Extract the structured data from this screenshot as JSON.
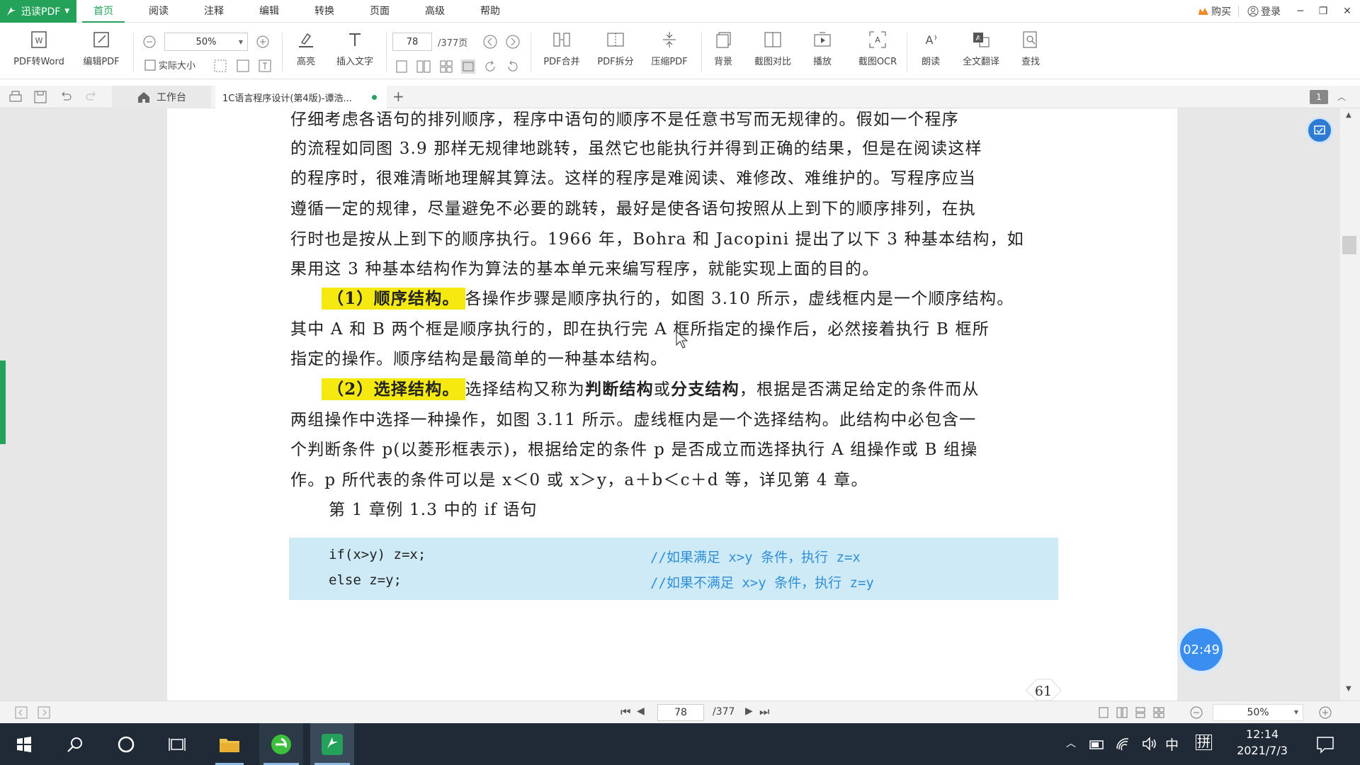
{
  "app": {
    "name": "迅读PDF"
  },
  "menu": {
    "items": [
      "首页",
      "阅读",
      "注释",
      "编辑",
      "转换",
      "页面",
      "高级",
      "帮助"
    ],
    "active": "首页"
  },
  "window": {
    "buy": "购买",
    "login": "登录"
  },
  "toolbar": {
    "pdf_to_word": "PDF转Word",
    "edit_pdf": "编辑PDF",
    "zoom_value": "50%",
    "actual_size": "实际大小",
    "highlight": "高亮",
    "insert_text": "插入文字",
    "page_current": "78",
    "page_total": "/377页",
    "pdf_merge": "PDF合并",
    "pdf_split": "PDF拆分",
    "compress_pdf": "压缩PDF",
    "background": "背景",
    "screenshot_compare": "截图对比",
    "play": "播放",
    "screenshot_ocr": "截图OCR",
    "read_aloud": "朗读",
    "full_translate": "全文翻译",
    "search": "查找"
  },
  "tabs": {
    "home": "工作台",
    "document": "1C语言程序设计(第4版)-谭浩...",
    "add": "+",
    "page_badge": "1"
  },
  "document": {
    "lines": [
      "仔细考虑各语句的排列顺序，程序中语句的顺序不是任意书写而无规律的。假如一个程序",
      "的流程如同图 3.9 那样无规律地跳转，虽然它也能执行并得到正确的结果，但是在阅读这样",
      "的程序时，很难清晰地理解其算法。这样的程序是难阅读、难修改、难维护的。写程序应当",
      "遵循一定的规律，尽量避免不必要的跳转，最好是使各语句按照从上到下的顺序排列，在执",
      "行时也是按从上到下的顺序执行。1966 年，Bohra 和 Jacopini 提出了以下 3 种基本结构，如",
      "果用这 3 种基本结构作为算法的基本单元来编写程序，就能实现上面的目的。"
    ],
    "seq_heading": "（1）顺序结构。",
    "seq_rest": "各操作步骤是顺序执行的，如图 3.10 所示，虚线框内是一个顺序结构。",
    "seq_line2": "其中 A 和 B 两个框是顺序执行的，即在执行完 A 框所指定的操作后，必然接着执行 B 框所",
    "seq_line3": "指定的操作。顺序结构是最简单的一种基本结构。",
    "sel_heading": "（2）选择结构。",
    "sel_a": "选择结构又称为",
    "sel_b1": "判断结构",
    "sel_or": "或",
    "sel_b2": "分支结构",
    "sel_c": "，根据是否满足给定的条件而从",
    "sel_line2": "两组操作中选择一种操作，如图 3.11 所示。虚线框内是一个选择结构。此结构中必包含一",
    "sel_line3": "个判断条件 p(以菱形框表示)，根据给定的条件 p 是否成立而选择执行 A 组操作或 B 组操",
    "sel_line4": "作。p 所代表的条件可以是 x＜0 或 x＞y，a＋b＜c＋d 等，详见第 4 章。",
    "example_line": "第 1 章例 1.3 中的 if 语句",
    "code": [
      {
        "code": "if(x>y) z=x;",
        "comment": "//如果满足 x>y 条件，执行 z=x"
      },
      {
        "code": "else z=y;",
        "comment": "//如果不满足 x>y 条件，执行 z=y"
      }
    ],
    "page_number": "61"
  },
  "timer": "02:49",
  "statusbar": {
    "page_current": "78",
    "page_total": "/377",
    "zoom": "50%"
  },
  "taskbar": {
    "ime": "中",
    "ime2": "拼",
    "time": "12:14",
    "date": "2021/7/3"
  },
  "colors": {
    "brand": "#25a25a",
    "highlight": "#f5e90f",
    "code_bg": "#cfeaf7",
    "comment": "#2f8fd6"
  }
}
